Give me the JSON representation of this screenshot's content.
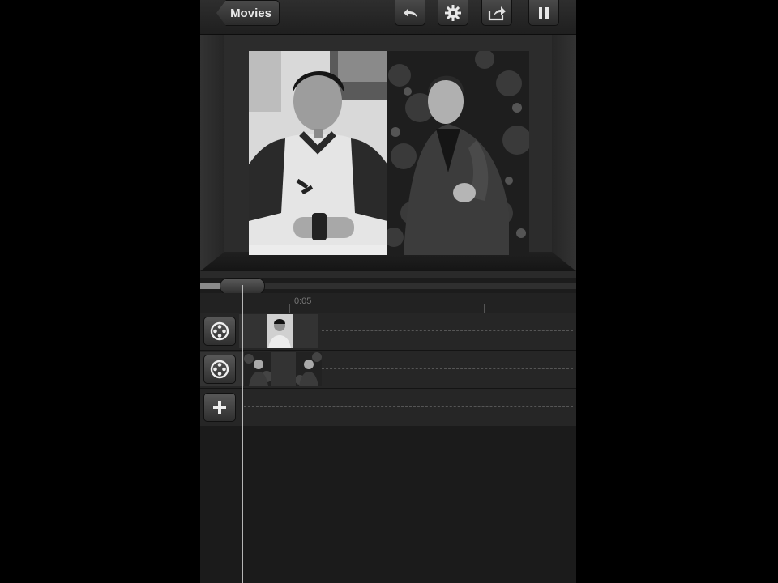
{
  "toolbar": {
    "back_label": "Movies",
    "buttons": [
      "undo-icon",
      "gear-icon",
      "share-icon",
      "pause-icon"
    ]
  },
  "timeline": {
    "ruler_label": "0:05",
    "playhead_progress": 0.11
  },
  "tracks": [
    {
      "icon": "film-reel-icon",
      "kind": "video"
    },
    {
      "icon": "film-reel-icon",
      "kind": "video"
    },
    {
      "icon": "plus-icon",
      "kind": "add"
    }
  ]
}
